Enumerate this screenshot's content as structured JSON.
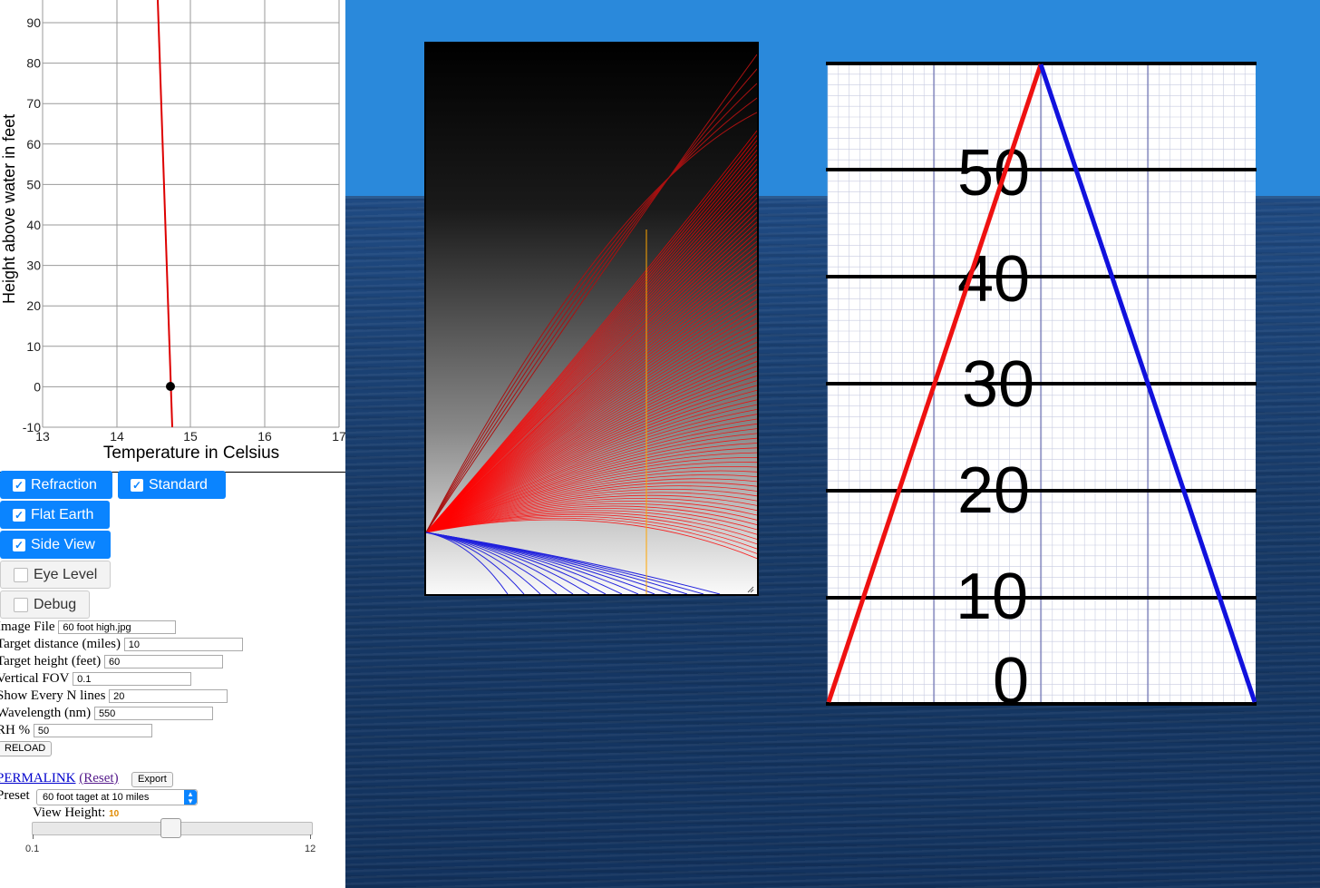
{
  "graph": {
    "y_label": "Height above water in feet",
    "x_label": "Temperature in Celsius",
    "y_ticks": [
      "90",
      "80",
      "70",
      "60",
      "50",
      "40",
      "30",
      "20",
      "10",
      "0",
      "-10"
    ],
    "x_ticks": [
      "13",
      "14",
      "15",
      "16",
      "17"
    ],
    "colors": {
      "line": "#dd0000",
      "point": "#000000",
      "grid": "#999999"
    }
  },
  "toggles": {
    "refraction": "Refraction",
    "standard": "Standard",
    "flat_earth": "Flat Earth",
    "side_view": "Side View",
    "eye_level": "Eye Level",
    "debug": "Debug"
  },
  "fields": {
    "image_file": {
      "label": "Image File",
      "value": "60 foot high.jpg"
    },
    "target_distance": {
      "label": "Target distance (miles)",
      "value": "10"
    },
    "target_height": {
      "label": "Target height (feet)",
      "value": "60"
    },
    "vertical_fov": {
      "label": "Vertical FOV",
      "value": "0.1"
    },
    "show_every": {
      "label": "Show Every N lines",
      "value": "20"
    },
    "wavelength": {
      "label": "Wavelength (nm)",
      "value": "550"
    },
    "rh": {
      "label": "RH %",
      "value": "50"
    }
  },
  "buttons": {
    "reload": "RELOAD",
    "export": "Export"
  },
  "links": {
    "permalink": "PERMALINK",
    "reset": "(Reset)"
  },
  "preset": {
    "label": "Preset",
    "value": "60 foot taget at 10 miles"
  },
  "view_height": {
    "label": "View Height:",
    "value": "10",
    "min": "0.1",
    "max": "12",
    "fraction": 0.47
  },
  "target_grid": {
    "labels": [
      "50",
      "40",
      "30",
      "20",
      "10",
      "0"
    ],
    "colors": {
      "left_edge": "#ee1111",
      "right_edge": "#1111dd",
      "lines": "#000000"
    }
  },
  "ray_diagram": {
    "colors": {
      "up_rays": "#ff0000",
      "down_rays": "#2222dd",
      "target": "#ffa500"
    }
  }
}
